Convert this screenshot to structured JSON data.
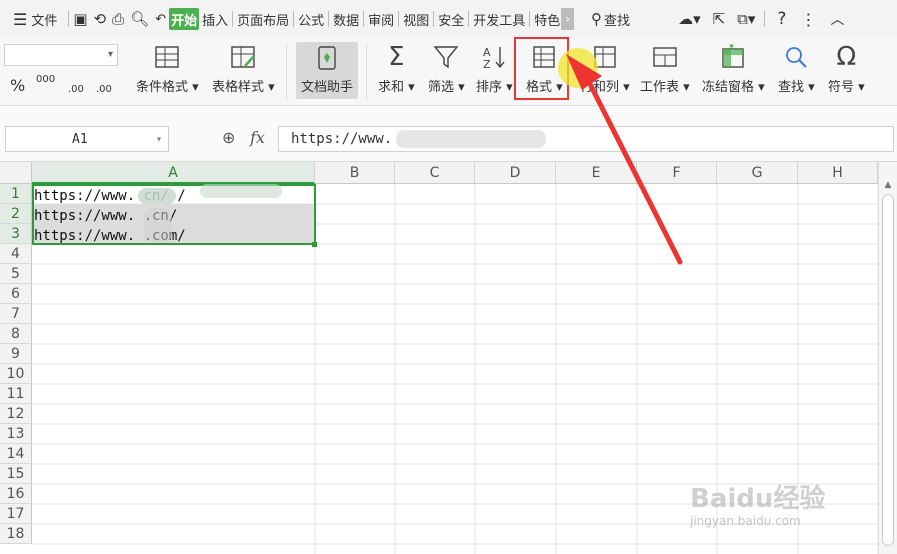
{
  "menubar": {
    "menu_label": "文件",
    "tabs": [
      "开始",
      "插入",
      "页面布局",
      "公式",
      "数据",
      "审阅",
      "视图",
      "安全",
      "开发工具",
      "特色"
    ],
    "active_tab": "开始",
    "search_label": "查找"
  },
  "ribbon": {
    "number_formats": [
      "000",
      ".00",
      ".00"
    ],
    "percent": "%",
    "buttons": [
      {
        "id": "cond-format",
        "label": "条件格式 ▾"
      },
      {
        "id": "table-style",
        "label": "表格样式 ▾"
      },
      {
        "id": "doc-assistant",
        "label": "文档助手"
      },
      {
        "id": "sum",
        "label": "求和 ▾"
      },
      {
        "id": "filter",
        "label": "筛选 ▾"
      },
      {
        "id": "sort",
        "label": "排序 ▾"
      },
      {
        "id": "format",
        "label": "格式 ▾"
      },
      {
        "id": "rowcol",
        "label": "行和列 ▾"
      },
      {
        "id": "worksheet",
        "label": "工作表 ▾"
      },
      {
        "id": "freeze",
        "label": "冻结窗格 ▾"
      },
      {
        "id": "find",
        "label": "查找 ▾"
      },
      {
        "id": "symbol",
        "label": "符号 ▾"
      }
    ]
  },
  "formula_bar": {
    "cell_ref": "A1",
    "fx": "fx",
    "content": "https://www."
  },
  "sheet": {
    "columns": [
      "A",
      "B",
      "C",
      "D",
      "E",
      "F",
      "G",
      "H"
    ],
    "rows": [
      "1",
      "2",
      "3",
      "4",
      "5",
      "6",
      "7",
      "8",
      "9",
      "10",
      "11",
      "12",
      "13",
      "14",
      "15",
      "16",
      "17",
      "18"
    ],
    "cells": [
      "https://www.    cn/        /",
      "https://www.    .cn/",
      "https://www.      .com/"
    ]
  },
  "watermark": "Baidu经验",
  "watermark_url": "jingyan.baidu.com",
  "colors": {
    "accent": "#4caf50",
    "highlight": "#e53935",
    "selection": "#2e9a3c"
  }
}
